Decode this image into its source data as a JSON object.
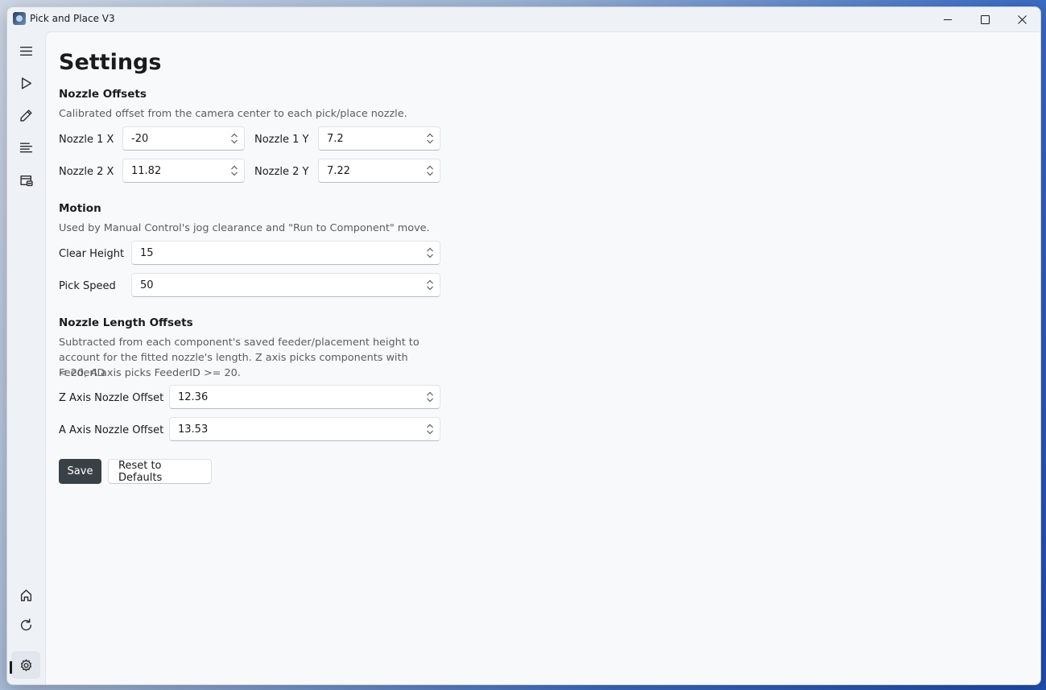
{
  "window": {
    "title": "Pick and Place V3"
  },
  "nav": {
    "top": [
      {
        "icon": "hamburger-menu-icon"
      },
      {
        "icon": "play-icon"
      },
      {
        "icon": "pencil-icon"
      },
      {
        "icon": "list-lines-icon"
      },
      {
        "icon": "feeder-storage-icon"
      }
    ],
    "bottom": [
      {
        "icon": "home-icon"
      },
      {
        "icon": "refresh-icon"
      },
      {
        "icon": "gear-icon",
        "selected": true
      }
    ]
  },
  "page": {
    "title": "Settings"
  },
  "nozzle_offsets": {
    "title": "Nozzle Offsets",
    "description": "Calibrated offset from the camera center to each pick/place nozzle.",
    "n1x": {
      "label": "Nozzle 1 X",
      "value": "-20"
    },
    "n1y": {
      "label": "Nozzle 1 Y",
      "value": "7.2"
    },
    "n2x": {
      "label": "Nozzle 2 X",
      "value": "11.82"
    },
    "n2y": {
      "label": "Nozzle 2 Y",
      "value": "7.22"
    }
  },
  "motion": {
    "title": "Motion",
    "description": "Used by Manual Control's jog clearance and \"Run to Component\" move.",
    "clear_height": {
      "label": "Clear Height",
      "value": "15"
    },
    "pick_speed": {
      "label": "Pick Speed",
      "value": "50"
    }
  },
  "length_offsets": {
    "title": "Nozzle Length Offsets",
    "description_line1": "Subtracted from each component's saved feeder/placement height to",
    "description_line2": "account for the fitted nozzle's length. Z axis picks components with FeederID",
    "description_line3": "< 20, A axis picks FeederID >= 20.",
    "z_axis": {
      "label": "Z Axis Nozzle Offset",
      "value": "12.36"
    },
    "a_axis": {
      "label": "A Axis Nozzle Offset",
      "value": "13.53"
    }
  },
  "actions": {
    "save_label": "Save",
    "reset_label": "Reset to Defaults"
  }
}
